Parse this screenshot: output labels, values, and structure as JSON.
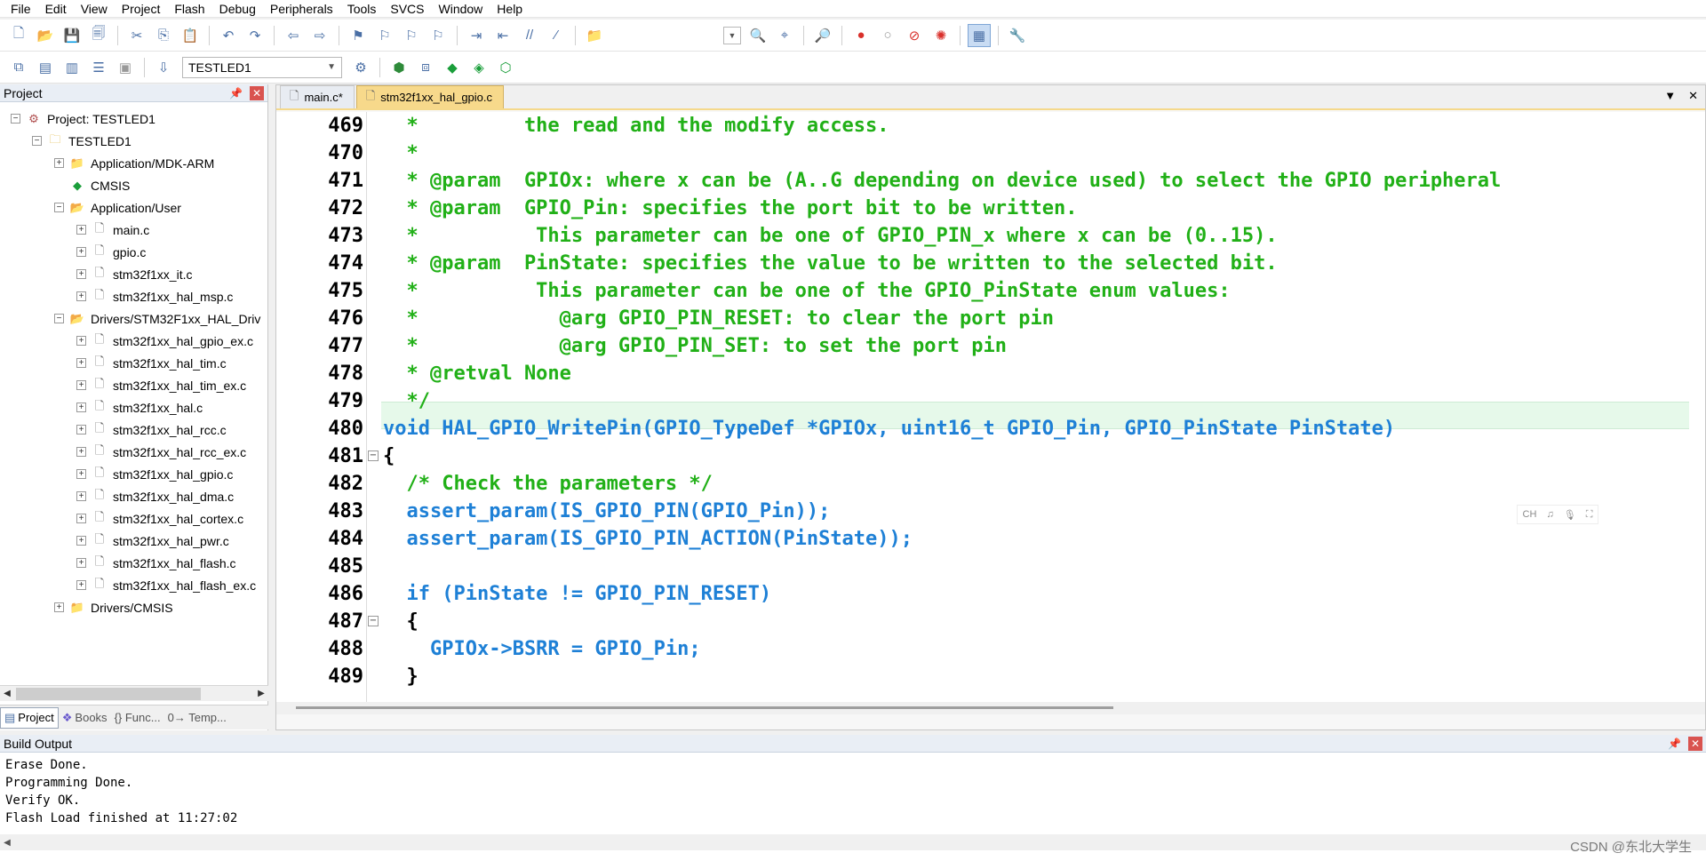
{
  "menu": [
    "File",
    "Edit",
    "View",
    "Project",
    "Flash",
    "Debug",
    "Peripherals",
    "Tools",
    "SVCS",
    "Window",
    "Help"
  ],
  "toolbar": {
    "target_name": "TESTLED1",
    "target_dropdown_icon": "chevron-down-icon"
  },
  "project_panel": {
    "title": "Project",
    "tree": [
      {
        "label": "Project: TESTLED1",
        "icon": "project-icon"
      },
      {
        "label": "TESTLED1",
        "icon": "target-icon"
      },
      {
        "label": "Application/MDK-ARM",
        "icon": "folder-icon"
      },
      {
        "label": "CMSIS",
        "icon": "gem-icon"
      },
      {
        "label": "Application/User",
        "icon": "folder-icon"
      },
      {
        "label": "main.c",
        "icon": "file-icon"
      },
      {
        "label": "gpio.c",
        "icon": "file-icon"
      },
      {
        "label": "stm32f1xx_it.c",
        "icon": "file-icon"
      },
      {
        "label": "stm32f1xx_hal_msp.c",
        "icon": "file-icon"
      },
      {
        "label": "Drivers/STM32F1xx_HAL_Driv",
        "icon": "folder-icon"
      },
      {
        "label": "stm32f1xx_hal_gpio_ex.c",
        "icon": "file-icon"
      },
      {
        "label": "stm32f1xx_hal_tim.c",
        "icon": "file-icon"
      },
      {
        "label": "stm32f1xx_hal_tim_ex.c",
        "icon": "file-icon"
      },
      {
        "label": "stm32f1xx_hal.c",
        "icon": "file-icon"
      },
      {
        "label": "stm32f1xx_hal_rcc.c",
        "icon": "file-icon"
      },
      {
        "label": "stm32f1xx_hal_rcc_ex.c",
        "icon": "file-icon"
      },
      {
        "label": "stm32f1xx_hal_gpio.c",
        "icon": "file-icon"
      },
      {
        "label": "stm32f1xx_hal_dma.c",
        "icon": "file-icon"
      },
      {
        "label": "stm32f1xx_hal_cortex.c",
        "icon": "file-icon"
      },
      {
        "label": "stm32f1xx_hal_pwr.c",
        "icon": "file-icon"
      },
      {
        "label": "stm32f1xx_hal_flash.c",
        "icon": "file-icon"
      },
      {
        "label": "stm32f1xx_hal_flash_ex.c",
        "icon": "file-icon"
      },
      {
        "label": "Drivers/CMSIS",
        "icon": "folder-icon"
      }
    ],
    "tabs": [
      "Project",
      "Books",
      "{} Func...",
      "0→ Temp..."
    ]
  },
  "editor": {
    "tabs": [
      {
        "label": "main.c*"
      },
      {
        "label": "stm32f1xx_hal_gpio.c"
      }
    ],
    "lines": [
      {
        "n": "469",
        "t": "  *         the read and the modify access."
      },
      {
        "n": "470",
        "t": "  *"
      },
      {
        "n": "471",
        "t": "  * @param  GPIOx: where x can be (A..G depending on device used) to select the GPIO peripheral"
      },
      {
        "n": "472",
        "t": "  * @param  GPIO_Pin: specifies the port bit to be written."
      },
      {
        "n": "473",
        "t": "  *          This parameter can be one of GPIO_PIN_x where x can be (0..15)."
      },
      {
        "n": "474",
        "t": "  * @param  PinState: specifies the value to be written to the selected bit."
      },
      {
        "n": "475",
        "t": "  *          This parameter can be one of the GPIO_PinState enum values:"
      },
      {
        "n": "476",
        "t": "  *            @arg GPIO_PIN_RESET: to clear the port pin"
      },
      {
        "n": "477",
        "t": "  *            @arg GPIO_PIN_SET: to set the port pin"
      },
      {
        "n": "478",
        "t": "  * @retval None"
      },
      {
        "n": "479",
        "t": "  */"
      },
      {
        "n": "480",
        "t": "void HAL_GPIO_WritePin(GPIO_TypeDef *GPIOx, uint16_t GPIO_Pin, GPIO_PinState PinState)"
      },
      {
        "n": "481",
        "t": "{"
      },
      {
        "n": "482",
        "t": "  /* Check the parameters */"
      },
      {
        "n": "483",
        "t": "  assert_param(IS_GPIO_PIN(GPIO_Pin));"
      },
      {
        "n": "484",
        "t": "  assert_param(IS_GPIO_PIN_ACTION(PinState));"
      },
      {
        "n": "485",
        "t": ""
      },
      {
        "n": "486",
        "t": "  if (PinState != GPIO_PIN_RESET)"
      },
      {
        "n": "487",
        "t": "  {"
      },
      {
        "n": "488",
        "t": "    GPIOx->BSRR = GPIO_Pin;"
      },
      {
        "n": "489",
        "t": "  }"
      }
    ],
    "floating_toolbar": [
      "CH",
      "♫",
      "🎙",
      "⛶"
    ]
  },
  "build_output": {
    "title": "Build Output",
    "lines": [
      "Erase Done.",
      "Programming Done.",
      "Verify OK.",
      "Flash Load finished at 11:27:02"
    ]
  },
  "watermark": "CSDN @东北大学生",
  "colors": {
    "comment": "#21b017",
    "keyword": "#e0001a",
    "identifier": "#1e80d6",
    "active_tab": "#f7d98b",
    "current_line": "#e6f9ea"
  }
}
